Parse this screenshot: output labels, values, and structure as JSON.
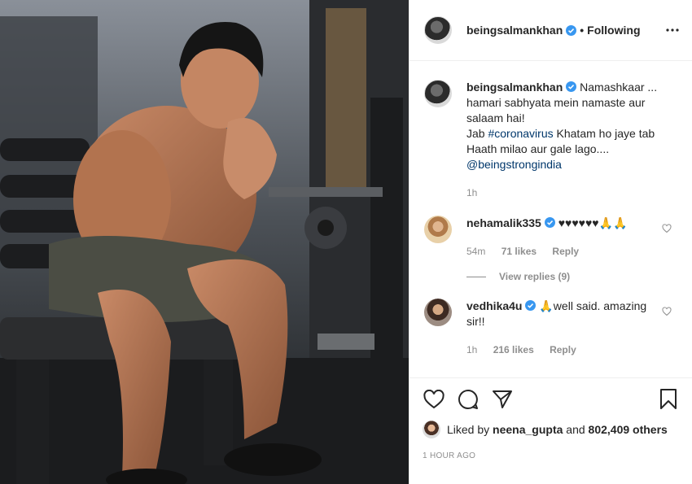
{
  "header": {
    "username": "beingsalmankhan",
    "separator": "•",
    "follow_status": "Following"
  },
  "caption": {
    "username": "beingsalmankhan",
    "text_part1": "Namashkaar ... hamari sabhyata mein namaste aur salaam hai!",
    "text_part2": "Jab",
    "hashtag": "#coronavirus",
    "text_part3": "Khatam ho jaye tab Haath milao aur gale lago....",
    "mention": "@beingstrongindia",
    "time": "1h"
  },
  "comments": [
    {
      "username": "nehamalik335",
      "text": "♥♥♥♥♥♥🙏🙏",
      "time": "54m",
      "likes": "71 likes",
      "reply_label": "Reply",
      "view_replies": "View replies (9)"
    },
    {
      "username": "vedhika4u",
      "text": "🙏well said. amazing sir!!",
      "time": "1h",
      "likes": "216 likes",
      "reply_label": "Reply"
    }
  ],
  "likes": {
    "prefix": "Liked by",
    "user": "neena_gupta",
    "joiner": "and",
    "others": "802,409 others"
  },
  "timestamp": "1 HOUR AGO",
  "icons": {
    "verified": "verified-badge-icon",
    "more": "more-options-icon",
    "like": "heart-icon",
    "comment": "comment-icon",
    "share": "share-icon",
    "save": "bookmark-icon"
  },
  "colors": {
    "verified": "#3897f0",
    "link": "#00376b",
    "muted": "#8e8e8e",
    "text": "#262626"
  }
}
